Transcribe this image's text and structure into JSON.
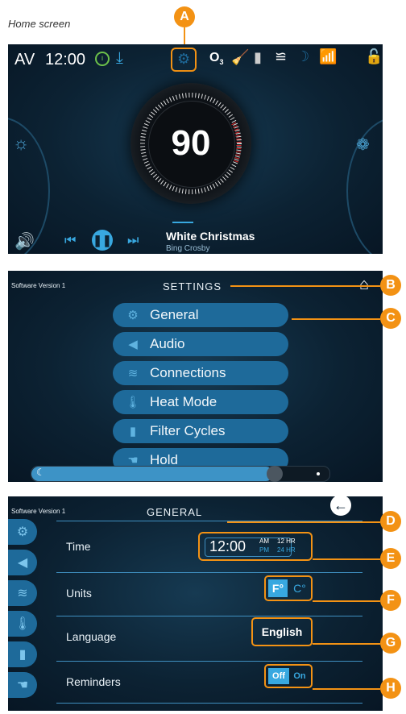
{
  "caption": "Home screen",
  "callouts": {
    "a": "A",
    "b": "B",
    "c": "C",
    "d": "D",
    "e": "E",
    "f": "F",
    "g": "G",
    "h": "H"
  },
  "home": {
    "av_label": "AV",
    "time": "12:00",
    "gauge_value": "90",
    "track_title": "White Christmas",
    "track_artist": "Bing Crosby"
  },
  "settings": {
    "software_version": "Software Version 1",
    "title": "SETTINGS",
    "items": [
      {
        "label": "General"
      },
      {
        "label": "Audio"
      },
      {
        "label": "Connections"
      },
      {
        "label": "Heat Mode"
      },
      {
        "label": "Filter Cycles"
      },
      {
        "label": "Hold"
      }
    ]
  },
  "general": {
    "software_version": "Software Version 1",
    "title": "GENERAL",
    "rows": {
      "time": {
        "label": "Time",
        "value": "12:00",
        "am": "AM",
        "pm": "PM",
        "h12": "12 HR",
        "h24": "24 HR"
      },
      "units": {
        "label": "Units",
        "f": "F°",
        "c": "C°"
      },
      "language": {
        "label": "Language",
        "value": "English"
      },
      "reminders": {
        "label": "Reminders",
        "off": "Off",
        "on": "On"
      }
    }
  },
  "colors": {
    "accent": "#f39214",
    "button_blue": "#1e6a9a",
    "highlight_blue": "#38a8e0"
  }
}
